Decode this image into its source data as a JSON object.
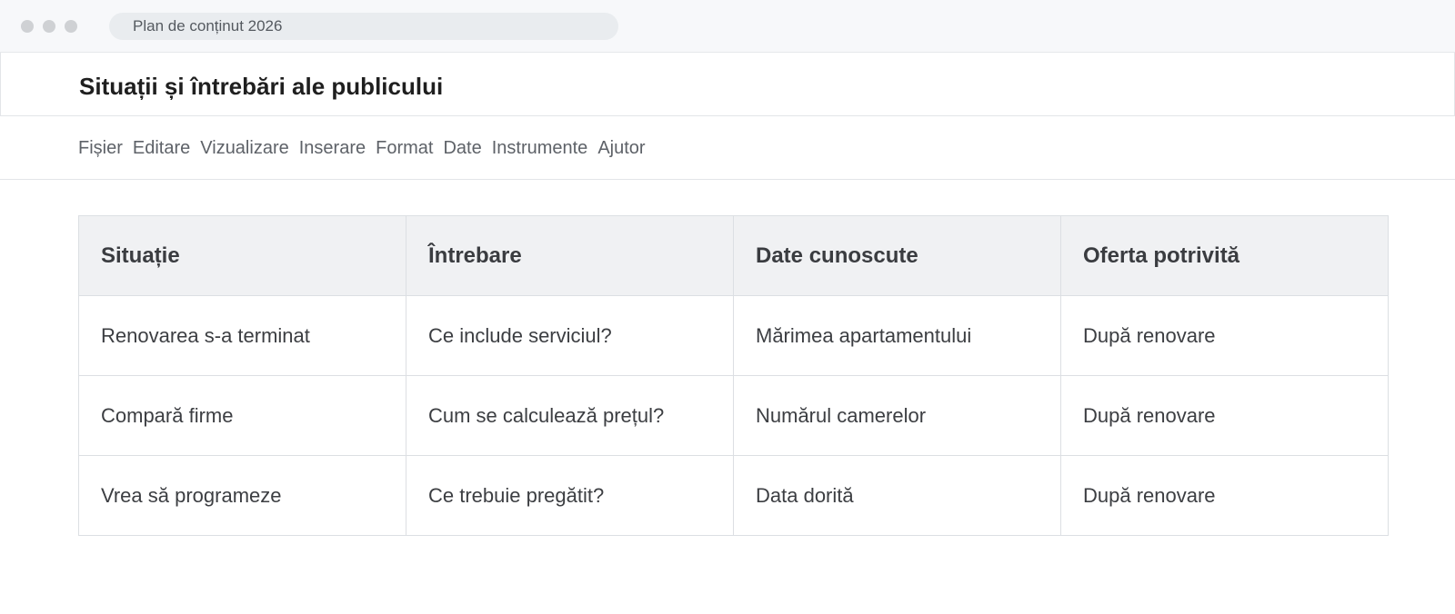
{
  "window": {
    "address": "Plan de conținut 2026"
  },
  "document": {
    "title": "Situații și întrebări ale publicului"
  },
  "menu": {
    "items": [
      "Fișier",
      "Editare",
      "Vizualizare",
      "Inserare",
      "Format",
      "Date",
      "Instrumente",
      "Ajutor"
    ]
  },
  "table": {
    "headers": [
      "Situație",
      "Întrebare",
      "Date cunoscute",
      "Oferta potrivită"
    ],
    "rows": [
      [
        "Renovarea s-a terminat",
        "Ce include serviciul?",
        "Mărimea apartamentului",
        "După renovare"
      ],
      [
        "Compară firme",
        "Cum se calculează prețul?",
        "Numărul camerelor",
        "După renovare"
      ],
      [
        "Vrea să programeze",
        "Ce trebuie pregătit?",
        "Data dorită",
        "După renovare"
      ]
    ]
  }
}
